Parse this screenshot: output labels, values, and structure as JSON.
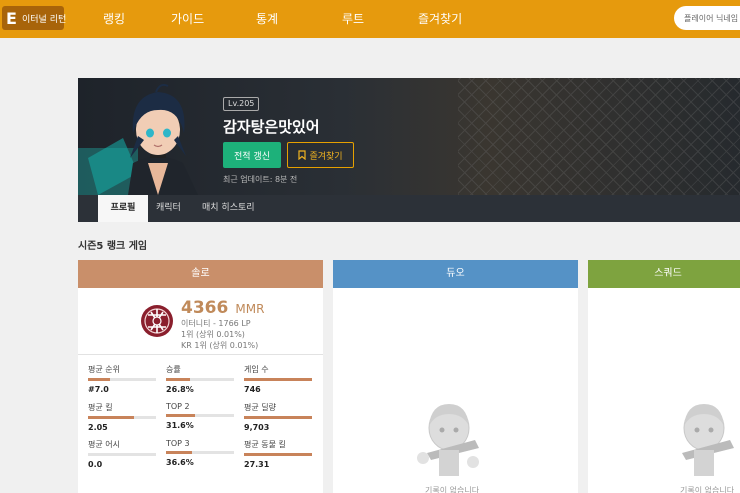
{
  "nav": {
    "logo_mark": "E",
    "logo_text": "이터널 리턴",
    "items": [
      "랭킹",
      "가이드",
      "통계",
      "루트",
      "즐겨찾기"
    ],
    "search_placeholder": "플레이어 닉네임"
  },
  "profile": {
    "level": "Lv.205",
    "nickname": "감자탕은맛있어",
    "refresh_label": "전적 갱신",
    "favorite_label": "즐겨찾기",
    "updated": "최근 업데이트: 8분 전"
  },
  "tabs": [
    "프로필",
    "캐릭터",
    "매치 히스토리"
  ],
  "season_title": "시즌5 랭크 게임",
  "colors": {
    "solo": "#c98f6a",
    "duo": "#5592c6",
    "squad": "#7ea33f",
    "accent": "#e69a0d"
  },
  "solo": {
    "header": "솔로",
    "mmr": "4366",
    "mmr_unit": "MMR",
    "tier": "이터니티 - 1766 LP",
    "rank": "1위 (상위 0.01%)",
    "kr_rank": "KR 1위 (상위 0.01%)",
    "stats": [
      {
        "label": "평균 순위",
        "value": "#7.0",
        "fill": 0.33
      },
      {
        "label": "승률",
        "value": "26.8%",
        "fill": 0.35
      },
      {
        "label": "게임 수",
        "value": "746",
        "fill": 1.0
      },
      {
        "label": "평균 킬",
        "value": "2.05",
        "fill": 0.68
      },
      {
        "label": "TOP 2",
        "value": "31.6%",
        "fill": 0.42
      },
      {
        "label": "평균 딜량",
        "value": "9,703",
        "fill": 1.0
      },
      {
        "label": "평균 어시",
        "value": "0.0",
        "fill": 0.0
      },
      {
        "label": "TOP 3",
        "value": "36.6%",
        "fill": 0.38
      },
      {
        "label": "평균 동물 킬",
        "value": "27.31",
        "fill": 1.0
      }
    ]
  },
  "duo": {
    "header": "듀오",
    "empty_text": "기록이 없습니다"
  },
  "squad": {
    "header": "스쿼드",
    "empty_text": "기록이 없습니다"
  }
}
